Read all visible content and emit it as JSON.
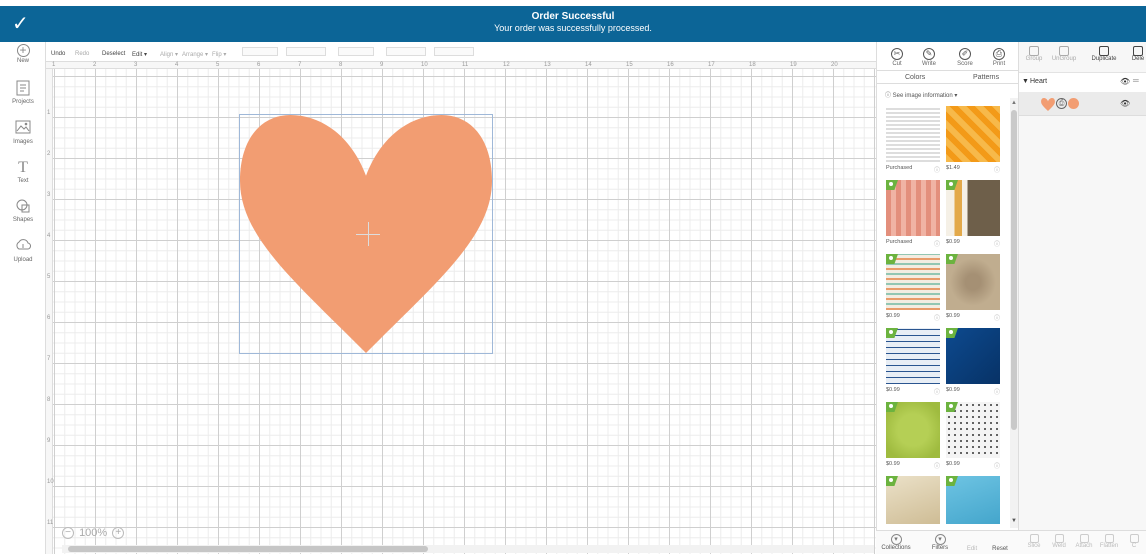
{
  "banner": {
    "title": "Order Successful",
    "subtitle": "Your order was successfully processed.",
    "icon": "check-icon",
    "color": "#0c6597"
  },
  "left_toolbar": {
    "items": [
      {
        "label": "New",
        "icon": "plus-circle-icon"
      },
      {
        "label": "Projects",
        "icon": "projects-icon"
      },
      {
        "label": "Images",
        "icon": "images-icon"
      },
      {
        "label": "Text",
        "icon": "text-icon"
      },
      {
        "label": "Shapes",
        "icon": "shapes-icon"
      },
      {
        "label": "Upload",
        "icon": "upload-icon"
      }
    ]
  },
  "edit_toolbar": {
    "undo": "Undo",
    "redo": "Redo",
    "deselect": "Deselect",
    "edit": "Edit",
    "align": "Align",
    "arrange": "Arrange",
    "flip": "Flip"
  },
  "ruler": {
    "top": [
      "1",
      "2",
      "3",
      "4",
      "5",
      "6",
      "7",
      "8",
      "9",
      "10",
      "11",
      "12",
      "13",
      "14",
      "15",
      "16",
      "17",
      "18",
      "19",
      "20"
    ],
    "left": [
      "1",
      "2",
      "3",
      "4",
      "5",
      "6",
      "7",
      "8",
      "9",
      "10",
      "11"
    ]
  },
  "canvas": {
    "shape_color": "#f29d72",
    "zoom": "100%"
  },
  "pattern_panel": {
    "modes": [
      {
        "label": "Cut",
        "icon": "cut-icon"
      },
      {
        "label": "Write",
        "icon": "write-icon"
      },
      {
        "label": "Score",
        "icon": "score-icon"
      },
      {
        "label": "Print",
        "icon": "print-icon"
      }
    ],
    "tabs": [
      "Colors",
      "Patterns"
    ],
    "see_info": "See image information",
    "tiles": [
      {
        "caption": "Purchased",
        "badge": false,
        "fill": "#e8e8e8",
        "pattern": "newspaper"
      },
      {
        "caption": "$1.49",
        "badge": false,
        "fill": "#f5a524",
        "pattern": "orange"
      },
      {
        "caption": "Purchased",
        "badge": true,
        "fill": "#e89a88",
        "pattern": "pink"
      },
      {
        "caption": "$0.99",
        "badge": true,
        "fill": "#6e5f4a",
        "pattern": "stripes"
      },
      {
        "caption": "$0.99",
        "badge": true,
        "fill": "#efe6d8",
        "pattern": "confetti"
      },
      {
        "caption": "$0.99",
        "badge": true,
        "fill": "#b8a486",
        "pattern": "sand"
      },
      {
        "caption": "$0.99",
        "badge": true,
        "fill": "#dce6f0",
        "pattern": "blueprint"
      },
      {
        "caption": "$0.99",
        "badge": true,
        "fill": "#0a3f7e",
        "pattern": "navy"
      },
      {
        "caption": "$0.99",
        "badge": true,
        "fill": "#a8c448",
        "pattern": "green"
      },
      {
        "caption": "$0.99",
        "badge": true,
        "fill": "#f0f0f0",
        "pattern": "dots"
      },
      {
        "caption": "",
        "badge": true,
        "fill": "#e0d5b8",
        "pattern": "map"
      },
      {
        "caption": "",
        "badge": true,
        "fill": "#5bb7d8",
        "pattern": "ocean"
      }
    ],
    "bottom": [
      {
        "label": "Collections",
        "icon": "collections-icon"
      },
      {
        "label": "Filters",
        "icon": "filters-icon"
      },
      {
        "label": "Edit",
        "icon": ""
      },
      {
        "label": "Reset",
        "icon": ""
      }
    ]
  },
  "layers_panel": {
    "toolbar": [
      {
        "label": "Group",
        "enabled": false
      },
      {
        "label": "UnGroup",
        "enabled": false
      },
      {
        "label": "Duplicate",
        "enabled": true
      },
      {
        "label": "Dele",
        "enabled": true
      }
    ],
    "group_name": "Heart",
    "bottom": [
      "Slice",
      "Weld",
      "Attach",
      "Flatten",
      "C"
    ]
  }
}
